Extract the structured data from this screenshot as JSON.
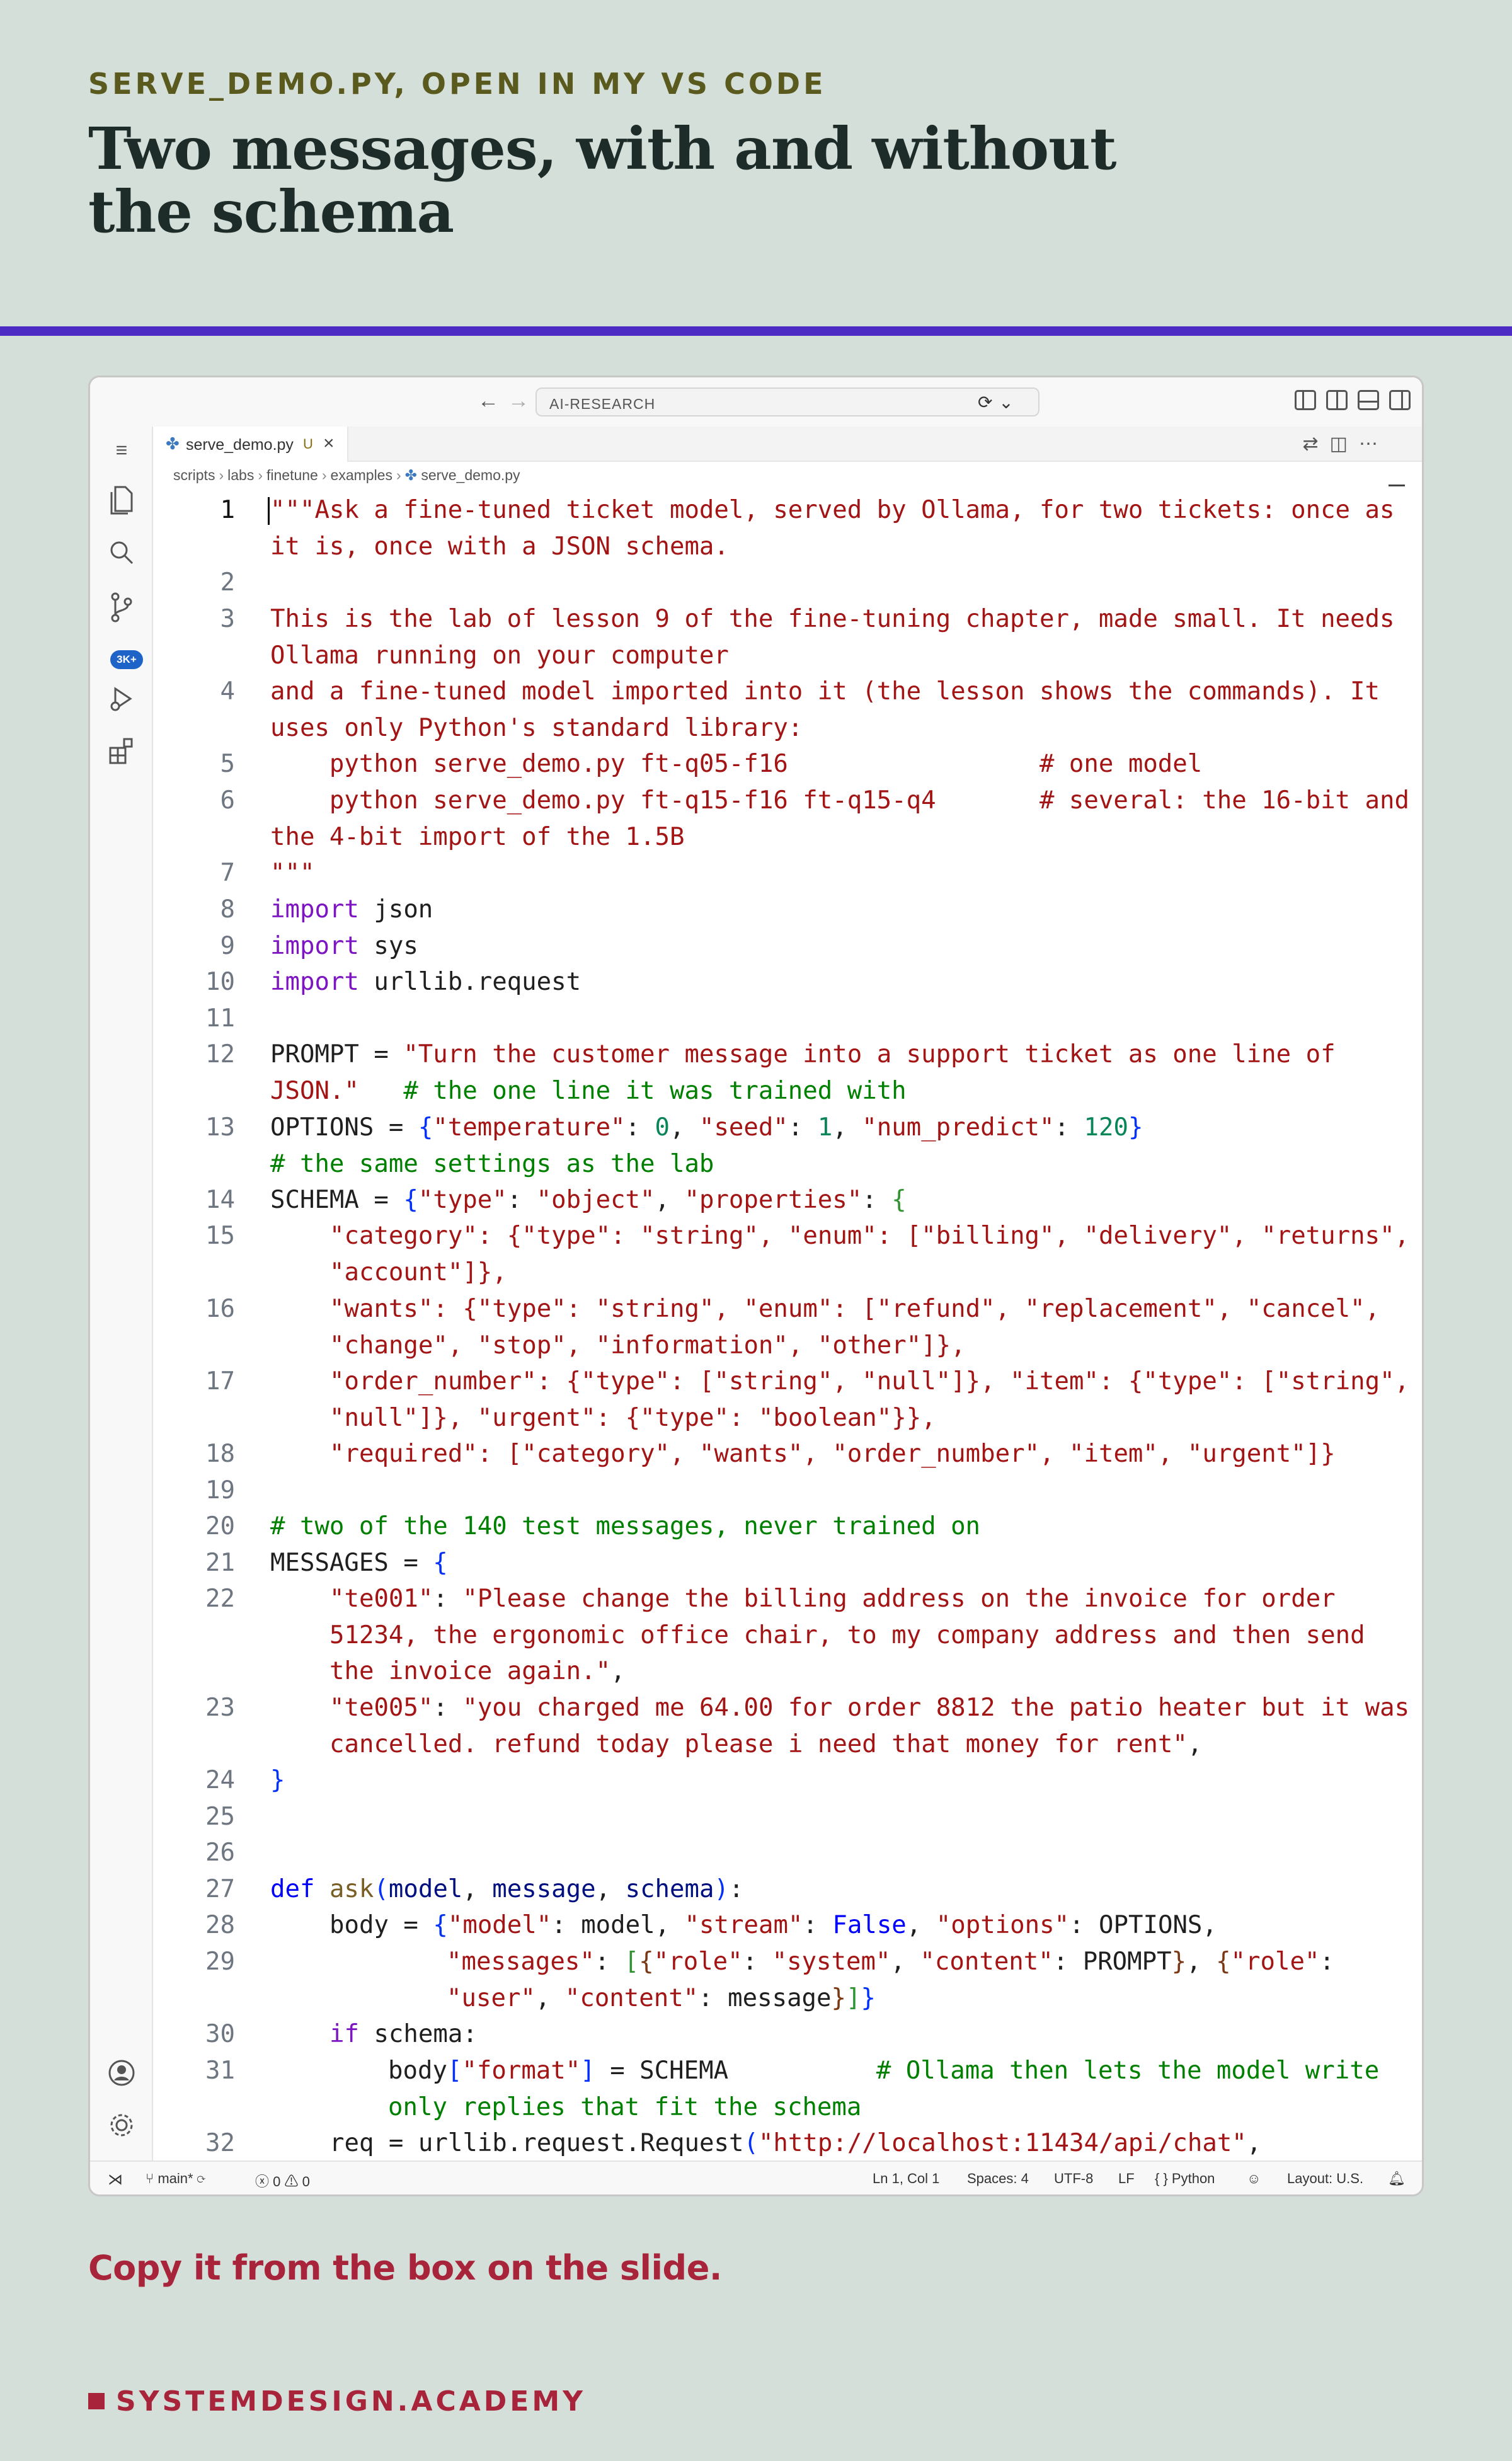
{
  "kicker": "SERVE_DEMO.PY, OPEN IN MY VS CODE",
  "headline": "Two messages, with and without the schema",
  "window": {
    "search_text": "AI-RESEARCH",
    "nav_back": "←",
    "nav_forward": "→"
  },
  "tab": {
    "filename": "serve_demo.py",
    "status": "U"
  },
  "breadcrumb": [
    "scripts",
    "labs",
    "finetune",
    "examples",
    "serve_demo.py"
  ],
  "activity_icons": [
    "menu-icon",
    "files-icon",
    "search-icon",
    "source-control-icon",
    "run-debug-icon",
    "extensions-icon",
    "account-icon",
    "gear-icon"
  ],
  "scm_badge": "3K+",
  "code_line_numbers": [
    "1",
    "2",
    "3",
    "4",
    "5",
    "6",
    "7",
    "8",
    "9",
    "10",
    "11",
    "12",
    "13",
    "14",
    "15",
    "16",
    "17",
    "18",
    "19",
    "20",
    "21",
    "22",
    "23",
    "24",
    "25",
    "26",
    "27",
    "28",
    "29",
    "30",
    "31",
    "32"
  ],
  "code": {
    "l1": "\"\"\"Ask a fine-tuned ticket model, served by Ollama, for two tickets: once as it is, once with a JSON schema.",
    "l3": "This is the lab of lesson 9 of the fine-tuning chapter, made small. It needs Ollama running on your computer",
    "l4": "and a fine-tuned model imported into it (the lesson shows the commands). It uses only Python's standard library:",
    "l5": "    python serve_demo.py ft-q05-f16                 # one model",
    "l6": "    python serve_demo.py ft-q15-f16 ft-q15-q4       # several: the 16-bit and the 4-bit import of the 1.5B",
    "l7": "\"\"\"",
    "l8_kw": "import",
    "l8_mod": " json",
    "l9_kw": "import",
    "l9_mod": " sys",
    "l10_kw": "import",
    "l10_mod": " urllib.request",
    "l12_var": "PROMPT = ",
    "l12_str": "\"Turn the customer message into a support ticket as one line of JSON.\"",
    "l12_cmt": "   # the one line it was trained with",
    "l13_var": "OPTIONS = ",
    "l13_k1": "\"temperature\"",
    "l13_v1": "0",
    "l13_k2": "\"seed\"",
    "l13_v2": "1",
    "l13_k3": "\"num_predict\"",
    "l13_v3": "120",
    "l13_cmt": "                         # the same settings as the lab",
    "l14_var": "SCHEMA = ",
    "l14_a": "\"type\"",
    "l14_b": "\"object\"",
    "l14_c": "\"properties\"",
    "l15": "\"category\": {\"type\": \"string\", \"enum\": [\"billing\", \"delivery\", \"returns\", \"account\"]},",
    "l16": "\"wants\": {\"type\": \"string\", \"enum\": [\"refund\", \"replacement\", \"cancel\", \"change\", \"stop\", \"information\", \"other\"]},",
    "l17": "\"order_number\": {\"type\": [\"string\", \"null\"]}, \"item\": {\"type\": [\"string\", \"null\"]}, \"urgent\": {\"type\": \"boolean\"}},",
    "l18": "\"required\": [\"category\", \"wants\", \"order_number\", \"item\", \"urgent\"]}",
    "l20": "# two of the 140 test messages, never trained on",
    "l21_var": "MESSAGES = ",
    "l22_key": "\"te001\"",
    "l22_val": "\"Please change the billing address on the invoice for order 51234, the ergonomic office chair, to my company address and then send the invoice again.\"",
    "l23_key": "\"te005\"",
    "l23_val": "\"you charged me 64.00 for order 8812 the patio heater but it was cancelled. refund today please i need that money for rent\"",
    "l27_kw": "def",
    "l27_fn": "ask",
    "l27_p1": "model",
    "l27_p2": "message",
    "l27_p3": "schema",
    "l28_a": "body = ",
    "l28_k1": "\"model\"",
    "l28_v1": " model, ",
    "l28_k2": "\"stream\"",
    "l28_v2": "False",
    "l28_k3": "\"options\"",
    "l28_v3": " OPTIONS,",
    "l29_k1": "\"messages\"",
    "l29_k2": "\"role\"",
    "l29_v2": "\"system\"",
    "l29_k3": "\"content\"",
    "l29_v3": " PROMPT",
    "l29_k4": "\"role\"",
    "l29_v4": "\"user\"",
    "l29_k5": "\"content\"",
    "l29_v5": " message",
    "l30_kw": "if",
    "l30_rest": " schema:",
    "l31_a": "body",
    "l31_k": "\"format\"",
    "l31_b": " = SCHEMA",
    "l31_cmt": "          # Ollama then lets the model write only replies that fit the schema",
    "l32_a": "req = urllib.request.Request",
    "l32_url": "\"http://localhost:11434/api/chat\"",
    "l32_b": ","
  },
  "status": {
    "branch": "main*",
    "errors": "0",
    "warnings": "0",
    "position": "Ln 1, Col 1",
    "spaces": "Spaces: 4",
    "encoding": "UTF-8",
    "eol": "LF",
    "language": "Python",
    "layout": "Layout: U.S."
  },
  "cta": "Copy it from the box on the slide.",
  "brand": "SYSTEMDESIGN.ACADEMY"
}
